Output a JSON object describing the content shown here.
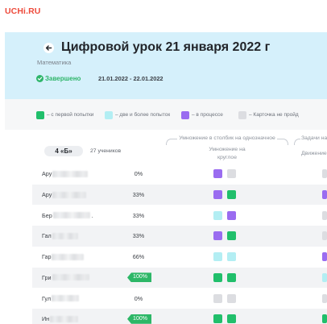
{
  "logo": "UCHi.RU",
  "colors": {
    "logo": "#ee4a3b",
    "banner": "#d5f0fb",
    "status": "#2eb56a",
    "score_complete": "#2db767",
    "row_alt": "#f2f3f5"
  },
  "lesson": {
    "back_icon": "arrow-left-icon",
    "title": "Цифровой урок 21 января 2022 г",
    "subject": "Математика",
    "status_icon": "check-circle-icon",
    "status": "Завершено",
    "dates": "21.01.2022 - 22.01.2022"
  },
  "legend": [
    {
      "label": "– с первой попытки",
      "color": "#21bf6b"
    },
    {
      "label": "– две и более попыток",
      "color": "#b3eef3"
    },
    {
      "label": "– в процессе",
      "color": "#9a6cf0"
    },
    {
      "label": "– Карточка не пройд",
      "color": "#dcdde1"
    }
  ],
  "table": {
    "class_name": "4 «Б»",
    "student_count": "27 учеников",
    "topics": [
      {
        "title": "Умножение в столбик на однозначное",
        "cards": [
          "Умножение на круглое"
        ]
      },
      {
        "title": "Задачи на",
        "cards": [
          "Движение"
        ]
      }
    ],
    "students": [
      {
        "name": "Ару",
        "score": "0%",
        "results": [
          [
            "#9a6cf0",
            "#dcdde1"
          ],
          [
            "#dcdde1"
          ]
        ]
      },
      {
        "name": "Ару",
        "score": "33%",
        "results": [
          [
            "#9a6cf0",
            "#21bf6b"
          ],
          [
            "#9a6cf0"
          ]
        ]
      },
      {
        "name": "Бер",
        "suffix": ".",
        "score": "33%",
        "results": [
          [
            "#b3eef3",
            "#9a6cf0"
          ],
          [
            "#dcdde1"
          ]
        ]
      },
      {
        "name": "Гал",
        "score": "33%",
        "results": [
          [
            "#9a6cf0",
            "#21bf6b"
          ],
          [
            "#dcdde1"
          ]
        ]
      },
      {
        "name": "Гар",
        "score": "66%",
        "results": [
          [
            "#b3eef3",
            "#b3eef3"
          ],
          [
            "#9a6cf0"
          ]
        ]
      },
      {
        "name": "Гри",
        "score": "100%",
        "results": [
          [
            "#21bf6b",
            "#21bf6b"
          ],
          [
            "#b3eef3"
          ]
        ]
      },
      {
        "name": "Гул",
        "score": "0%",
        "results": [
          [
            "#dcdde1",
            "#dcdde1"
          ],
          [
            "#dcdde1"
          ]
        ]
      },
      {
        "name": "Ин",
        "score": "100%",
        "results": [
          [
            "#21bf6b",
            "#21bf6b"
          ],
          [
            "#21bf6b"
          ]
        ]
      }
    ]
  }
}
